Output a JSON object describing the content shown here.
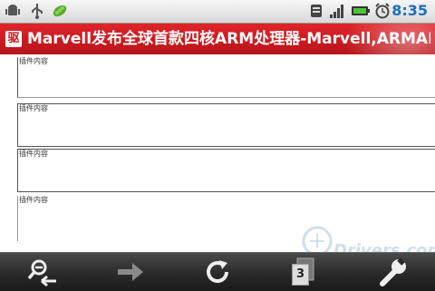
{
  "status_bar": {
    "time": "8:35",
    "icons": [
      "android-debug-icon",
      "usb-icon",
      "pea-pod-icon",
      "signal-icon",
      "signal-bars-icon",
      "battery-icon",
      "alarm-icon"
    ]
  },
  "title_bar": {
    "site_icon_char": "驱",
    "title": "Marvell发布全球首款四核ARM处理器-Marvell,ARMADA"
  },
  "content": {
    "plugins": [
      {
        "label": "插件内容"
      },
      {
        "label": "插件内容"
      },
      {
        "label": "插件内容"
      },
      {
        "label": "插件内容"
      }
    ]
  },
  "toolbar": {
    "buttons": [
      "zoom-out-back-icon",
      "forward-arrow-icon",
      "refresh-icon",
      "tabs-icon",
      "settings-wrench-icon"
    ],
    "tab_count": "3"
  },
  "watermark": {
    "text": "Drivers.com"
  },
  "colors": {
    "title_bg": "#c8161d",
    "time": "#1d6fbf",
    "toolbar_bg": "#2a2a2a"
  }
}
